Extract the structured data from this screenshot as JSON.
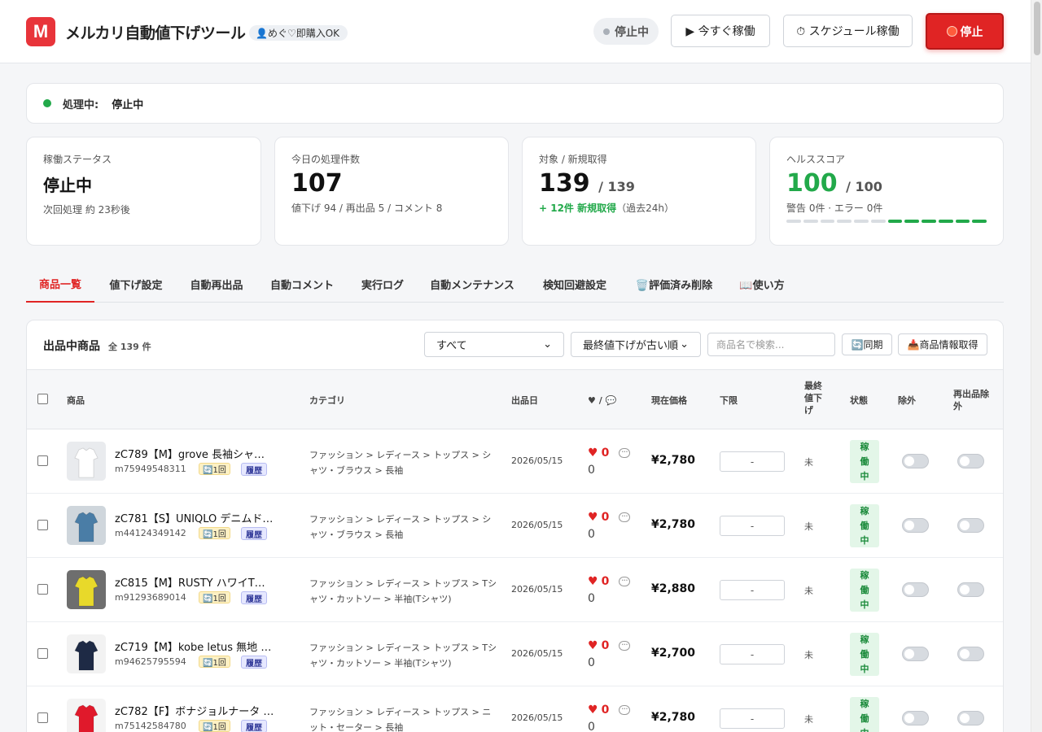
{
  "header": {
    "logo_letter": "M",
    "title": "メルカリ自動値下げツール",
    "account": "👤めぐ♡即購入OK",
    "status": "停止中",
    "run_now": "▶ 今すぐ稼働",
    "schedule": "⏱ スケジュール稼働",
    "stop": "停止"
  },
  "processing": {
    "label": "処理中:",
    "value": "停止中"
  },
  "cards": [
    {
      "label": "稼働ステータス",
      "big": "停止中",
      "sub": "次回処理 約 23秒後"
    },
    {
      "label": "今日の処理件数",
      "num": "107",
      "sub": "値下げ 94 / 再出品 5 / コメント 8"
    },
    {
      "label": "対象 / 新規取得",
      "num": "139",
      "num_sub": "/ 139",
      "sub_green": "+ 12件 新規取得",
      "sub_rest": "（過去24h）"
    },
    {
      "label": "ヘルススコア",
      "num": "100",
      "num_sub": "/ 100",
      "sub": "警告 0件 · エラー 0件",
      "health_level": 6,
      "health_total": 12
    }
  ],
  "tabs": [
    "商品一覧",
    "値下げ設定",
    "自動再出品",
    "自動コメント",
    "実行ログ",
    "自動メンテナンス",
    "検知回避設定",
    "🗑️評価済み削除",
    "📖使い方"
  ],
  "panel": {
    "title": "出品中商品",
    "count": "全 139 件",
    "filter_value": "すべて",
    "sort_value": "最終値下げが古い順",
    "search_placeholder": "商品名で検索...",
    "sync": "🔄同期",
    "fetch": "📥商品情報取得"
  },
  "columns": {
    "product": "商品",
    "category": "カテゴリ",
    "listed_date": "出品日",
    "likes_comments": "♥ / 💬",
    "price": "現在価格",
    "floor": "下限",
    "last_markdown": "最終値下げ",
    "state": "状態",
    "exclude": "除外",
    "relist_exclude": "再出品除外"
  },
  "rows": [
    {
      "name": "zC789【M】grove 長袖シャ…",
      "id": "m75949548311",
      "relist": "🔄1回",
      "history": "履歴",
      "category": "ファッション > レディース > トップス > シャツ・ブラウス > 長袖",
      "date": "2026/05/15",
      "likes": "0",
      "comments": "0",
      "price": "¥2,780",
      "floor": "-",
      "last": "未",
      "state": "稼働中",
      "thumb_bg": "#e9ebee",
      "thumb_fg": "#ffffff"
    },
    {
      "name": "zC781【S】UNIQLO デニムド…",
      "id": "m44124349142",
      "relist": "🔄1回",
      "history": "履歴",
      "category": "ファッション > レディース > トップス > シャツ・ブラウス > 長袖",
      "date": "2026/05/15",
      "likes": "0",
      "comments": "0",
      "price": "¥2,780",
      "floor": "-",
      "last": "未",
      "state": "稼働中",
      "thumb_bg": "#cfd6dc",
      "thumb_fg": "#4a7da6"
    },
    {
      "name": "zC815【M】RUSTY ハワイT…",
      "id": "m91293689014",
      "relist": "🔄1回",
      "history": "履歴",
      "category": "ファッション > レディース > トップス > Tシャツ・カットソー > 半袖(Tシャツ)",
      "date": "2026/05/15",
      "likes": "0",
      "comments": "0",
      "price": "¥2,880",
      "floor": "-",
      "last": "未",
      "state": "稼働中",
      "thumb_bg": "#6e6e6e",
      "thumb_fg": "#e8d92a"
    },
    {
      "name": "zC719【M】kobe letus 無地 …",
      "id": "m94625795594",
      "relist": "🔄1回",
      "history": "履歴",
      "category": "ファッション > レディース > トップス > Tシャツ・カットソー > 半袖(Tシャツ)",
      "date": "2026/05/15",
      "likes": "0",
      "comments": "0",
      "price": "¥2,700",
      "floor": "-",
      "last": "未",
      "state": "稼働中",
      "thumb_bg": "#f2f2f2",
      "thumb_fg": "#1e2a45"
    },
    {
      "name": "zC782【F】ボナジョルナータ …",
      "id": "m75142584780",
      "relist": "🔄1回",
      "history": "履歴",
      "category": "ファッション > レディース > トップス > ニット・セーター > 長袖",
      "date": "2026/05/15",
      "likes": "0",
      "comments": "0",
      "price": "¥2,780",
      "floor": "-",
      "last": "未",
      "state": "稼働中",
      "thumb_bg": "#f4f4f4",
      "thumb_fg": "#e0192b"
    }
  ],
  "colors": {
    "accent": "#e02424",
    "ok": "#22a94a",
    "hist": "#333b9a"
  }
}
